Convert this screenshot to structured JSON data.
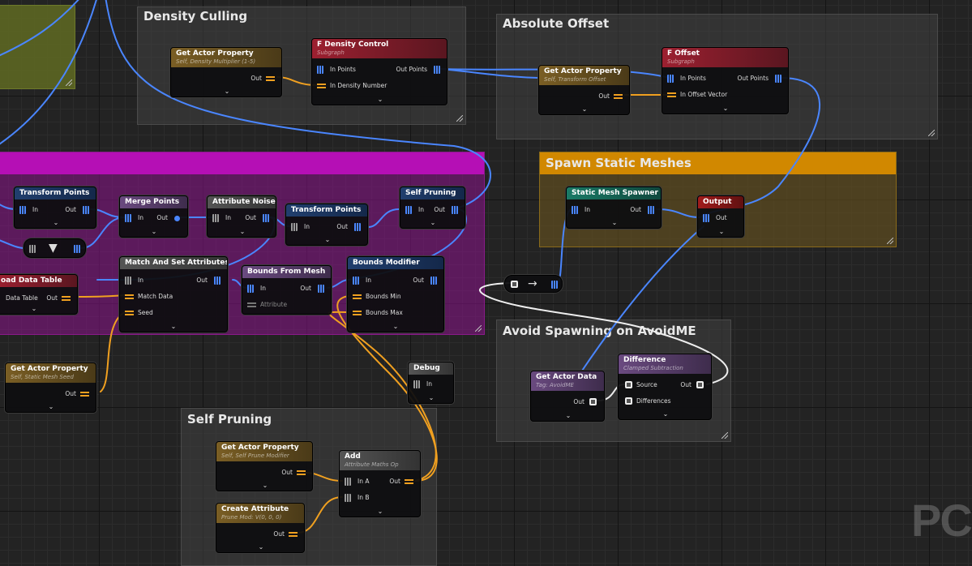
{
  "graph": {
    "comments": {
      "density_culling": "Density Culling",
      "absolute_offset": "Absolute Offset",
      "spawn_static_meshes": "Spawn Static Meshes",
      "avoid_spawning": "Avoid Spawning on AvoidME",
      "self_pruning": "Self Pruning"
    },
    "nodes": {
      "gap_density": {
        "title": "Get Actor Property",
        "subtitle": "Self, Density Multiplier (1-5)",
        "out": "Out"
      },
      "f_density": {
        "title": "F Density Control",
        "subtitle": "Subgraph",
        "in_points": "In Points",
        "in_density": "In Density Number",
        "out_points": "Out Points"
      },
      "gap_transform": {
        "title": "Get Actor Property",
        "subtitle": "Self, Transform Offset",
        "out": "Out"
      },
      "f_offset": {
        "title": "F Offset",
        "subtitle": "Subgraph",
        "in_points": "In Points",
        "in_offset": "In Offset Vector",
        "out_points": "Out Points"
      },
      "static_mesh_spawner": {
        "title": "Static Mesh Spawner",
        "in": "In",
        "out": "Out"
      },
      "output": {
        "title": "Output",
        "out": "Out"
      },
      "transform_points_1": {
        "title": "Transform Points",
        "in": "In",
        "out": "Out"
      },
      "merge_points": {
        "title": "Merge Points",
        "in": "In",
        "out": "Out"
      },
      "attribute_noise": {
        "title": "Attribute Noise",
        "in": "In",
        "out": "Out"
      },
      "transform_points_2": {
        "title": "Transform Points",
        "in": "In",
        "out": "Out"
      },
      "self_pruning_node": {
        "title": "Self Pruning",
        "in": "In",
        "out": "Out"
      },
      "load_data_table": {
        "title": "oad Data Table",
        "data_table": "Data Table",
        "out": "Out"
      },
      "match_and_set": {
        "title": "Match And Set Attributes",
        "in": "In",
        "out": "Out",
        "match_data": "Match Data",
        "seed": "Seed"
      },
      "bounds_from_mesh": {
        "title": "Bounds From Mesh",
        "in": "In",
        "out": "Out",
        "attribute": "Attribute"
      },
      "bounds_modifier": {
        "title": "Bounds Modifier",
        "in": "In",
        "out": "Out",
        "bounds_min": "Bounds Min",
        "bounds_max": "Bounds Max"
      },
      "gap_seed": {
        "title": "Get Actor Property",
        "subtitle": "Self, Static Mesh Seed",
        "out": "Out"
      },
      "debug": {
        "title": "Debug",
        "in": "In"
      },
      "get_actor_data": {
        "title": "Get Actor Data",
        "subtitle": "Tag: AvoidME",
        "out": "Out"
      },
      "difference": {
        "title": "Difference",
        "subtitle": "Clamped Subtraction",
        "source": "Source",
        "differences": "Differences",
        "out": "Out"
      },
      "gap_prune": {
        "title": "Get Actor Property",
        "subtitle": "Self, Self Prune Modifier",
        "out": "Out"
      },
      "add": {
        "title": "Add",
        "subtitle": "Attribute Maths Op",
        "in_a": "In A",
        "in_b": "In B",
        "out": "Out"
      },
      "create_attribute": {
        "title": "Create Attribute",
        "subtitle": "Prune Mod: V(0, 0, 0)",
        "out": "Out"
      }
    }
  },
  "watermark": "PC",
  "colors": {
    "subgraph_header": "#8c1c26",
    "get_property_header": "#6e5420",
    "spatial_header": "#1b3a66",
    "sampler_header": "#5a3d6e",
    "spawner_header": "#186a5a",
    "output_header": "#8f1c1c",
    "magenta_comment": "#b50fb5",
    "orange_comment": "#d18800",
    "olive_comment": "#5f6a22",
    "wire_points": "#4a86ff",
    "wire_attribute": "#f0a020",
    "wire_spatial": "#eeeeee"
  }
}
